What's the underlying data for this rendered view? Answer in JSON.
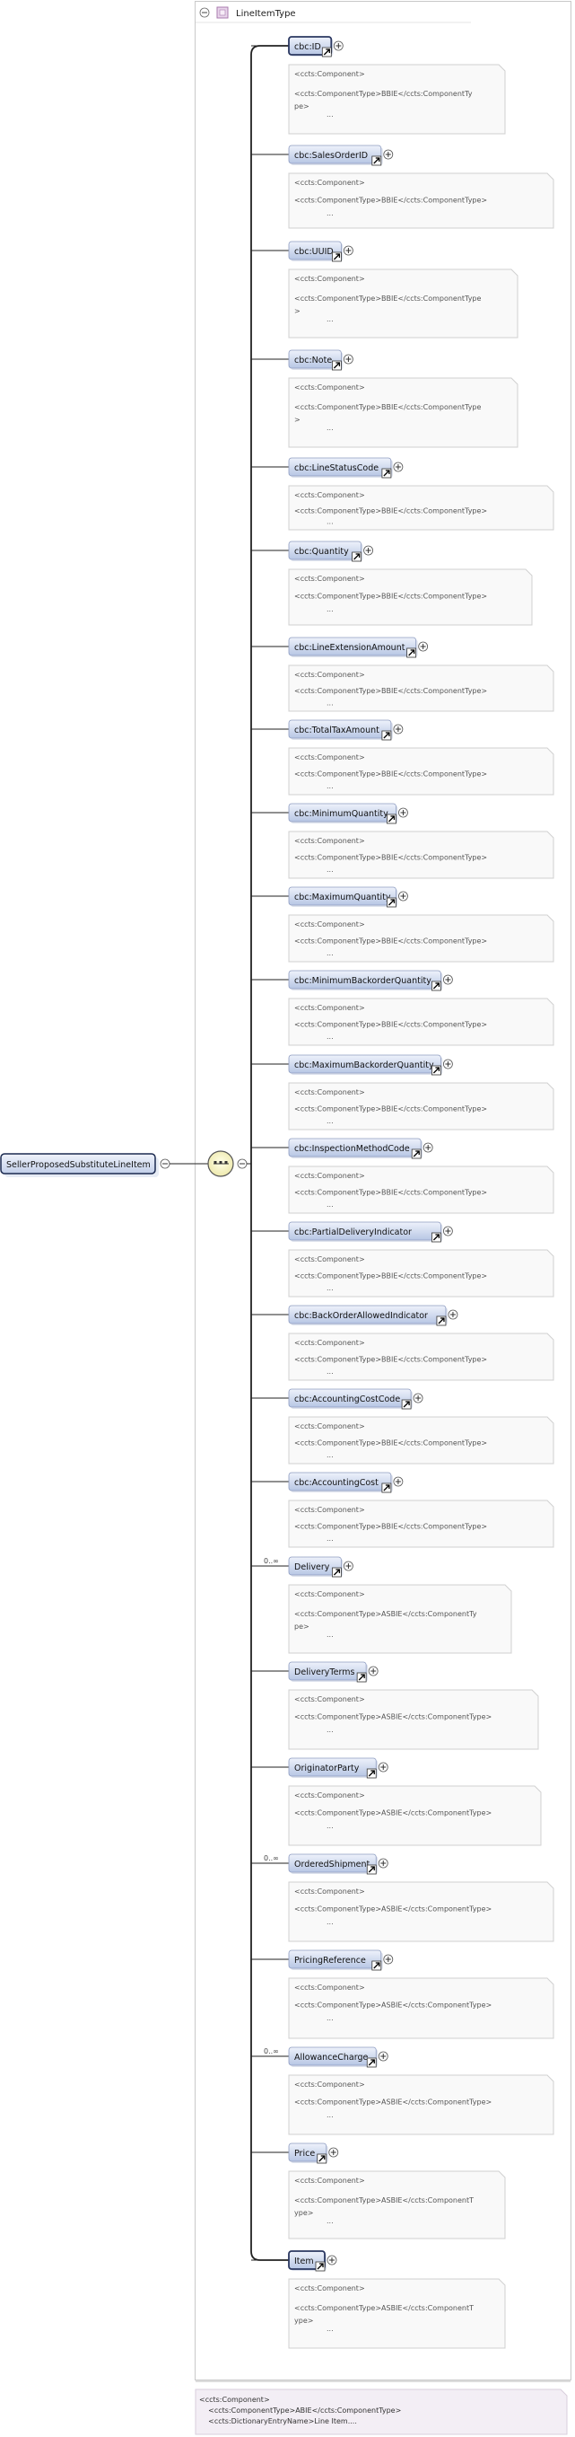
{
  "type_header": {
    "label": "LineItemType",
    "collapse_glyph": "−"
  },
  "root": {
    "label": "SellerProposedSubstituteLineItem"
  },
  "sequence": {
    "icon": "sequence-compositor-icon"
  },
  "elements": [
    {
      "name": "cbc:ID",
      "required": true,
      "multiplicity": "",
      "ann": [
        "<ccts:Component>",
        "<ccts:ComponentType>BBIE</ccts:ComponentTy",
        "pe>",
        "..."
      ]
    },
    {
      "name": "cbc:SalesOrderID",
      "required": false,
      "multiplicity": "",
      "ann": [
        "<ccts:Component>",
        "<ccts:ComponentType>BBIE</ccts:ComponentType>",
        "..."
      ]
    },
    {
      "name": "cbc:UUID",
      "required": false,
      "multiplicity": "",
      "ann": [
        "<ccts:Component>",
        "<ccts:ComponentType>BBIE</ccts:ComponentType",
        ">",
        "..."
      ]
    },
    {
      "name": "cbc:Note",
      "required": false,
      "multiplicity": "",
      "ann": [
        "<ccts:Component>",
        "<ccts:ComponentType>BBIE</ccts:ComponentType",
        ">",
        "..."
      ]
    },
    {
      "name": "cbc:LineStatusCode",
      "required": false,
      "multiplicity": "",
      "ann": [
        "<ccts:Component>",
        "    <ccts:ComponentType>BBIE</ccts:ComponentType>",
        "..."
      ]
    },
    {
      "name": "cbc:Quantity",
      "required": false,
      "multiplicity": "",
      "ann": [
        "<ccts:Component>",
        "<ccts:ComponentType>BBIE</ccts:ComponentType>",
        "..."
      ]
    },
    {
      "name": "cbc:LineExtensionAmount",
      "required": false,
      "multiplicity": "",
      "ann": [
        "<ccts:Component>",
        "    <ccts:ComponentType>BBIE</ccts:ComponentType>",
        "..."
      ]
    },
    {
      "name": "cbc:TotalTaxAmount",
      "required": false,
      "multiplicity": "",
      "ann": [
        "<ccts:Component>",
        "    <ccts:ComponentType>BBIE</ccts:ComponentType>",
        "..."
      ]
    },
    {
      "name": "cbc:MinimumQuantity",
      "required": false,
      "multiplicity": "",
      "ann": [
        "<ccts:Component>",
        "    <ccts:ComponentType>BBIE</ccts:ComponentType>",
        "..."
      ]
    },
    {
      "name": "cbc:MaximumQuantity",
      "required": false,
      "multiplicity": "",
      "ann": [
        "<ccts:Component>",
        "    <ccts:ComponentType>BBIE</ccts:ComponentType>",
        "..."
      ]
    },
    {
      "name": "cbc:MinimumBackorderQuantity",
      "required": false,
      "multiplicity": "",
      "ann": [
        "<ccts:Component>",
        "    <ccts:ComponentType>BBIE</ccts:ComponentType>",
        "..."
      ]
    },
    {
      "name": "cbc:MaximumBackorderQuantity",
      "required": false,
      "multiplicity": "",
      "ann": [
        "<ccts:Component>",
        "    <ccts:ComponentType>BBIE</ccts:ComponentType>",
        "..."
      ]
    },
    {
      "name": "cbc:InspectionMethodCode",
      "required": false,
      "multiplicity": "",
      "ann": [
        "<ccts:Component>",
        "    <ccts:ComponentType>BBIE</ccts:ComponentType>",
        "..."
      ]
    },
    {
      "name": "cbc:PartialDeliveryIndicator",
      "required": false,
      "multiplicity": "",
      "ann": [
        "<ccts:Component>",
        "    <ccts:ComponentType>BBIE</ccts:ComponentType>",
        "..."
      ]
    },
    {
      "name": "cbc:BackOrderAllowedIndicator",
      "required": false,
      "multiplicity": "",
      "ann": [
        "<ccts:Component>",
        "    <ccts:ComponentType>BBIE</ccts:ComponentType>",
        "..."
      ]
    },
    {
      "name": "cbc:AccountingCostCode",
      "required": false,
      "multiplicity": "",
      "ann": [
        "<ccts:Component>",
        "    <ccts:ComponentType>BBIE</ccts:ComponentType>",
        "..."
      ]
    },
    {
      "name": "cbc:AccountingCost",
      "required": false,
      "multiplicity": "",
      "ann": [
        "<ccts:Component>",
        "    <ccts:ComponentType>BBIE</ccts:ComponentType>",
        "..."
      ]
    },
    {
      "name": "Delivery",
      "required": false,
      "multiplicity": "0..∞",
      "ann": [
        "<ccts:Component>",
        "<ccts:ComponentType>ASBIE</ccts:ComponentTy",
        "pe>",
        "..."
      ]
    },
    {
      "name": "DeliveryTerms",
      "required": false,
      "multiplicity": "",
      "ann": [
        "<ccts:Component>",
        "<ccts:ComponentType>ASBIE</ccts:ComponentType>",
        "..."
      ]
    },
    {
      "name": "OriginatorParty",
      "required": false,
      "multiplicity": "",
      "ann": [
        "<ccts:Component>",
        "<ccts:ComponentType>ASBIE</ccts:ComponentType>",
        "..."
      ]
    },
    {
      "name": "OrderedShipment",
      "required": false,
      "multiplicity": "0..∞",
      "ann": [
        "<ccts:Component>",
        "<ccts:ComponentType>ASBIE</ccts:ComponentType>",
        "..."
      ]
    },
    {
      "name": "PricingReference",
      "required": false,
      "multiplicity": "",
      "ann": [
        "<ccts:Component>",
        "<ccts:ComponentType>ASBIE</ccts:ComponentType>",
        "..."
      ]
    },
    {
      "name": "AllowanceCharge",
      "required": false,
      "multiplicity": "0..∞",
      "ann": [
        "<ccts:Component>",
        "<ccts:ComponentType>ASBIE</ccts:ComponentType>",
        "..."
      ]
    },
    {
      "name": "Price",
      "required": false,
      "multiplicity": "",
      "ann": [
        "<ccts:Component>",
        "<ccts:ComponentType>ASBIE</ccts:ComponentT",
        "ype>",
        "..."
      ]
    },
    {
      "name": "Item",
      "required": true,
      "multiplicity": "",
      "ann": [
        "<ccts:Component>",
        "<ccts:ComponentType>ASBIE</ccts:ComponentT",
        "ype>",
        "..."
      ]
    }
  ],
  "bottom_annotation": [
    "<ccts:Component>",
    "    <ccts:ComponentType>ABIE</ccts:ComponentType>",
    "    <ccts:DictionaryEntryName>Line Item...."
  ],
  "colors": {
    "element_fill_top": "#e9eefa",
    "element_fill_bottom": "#b9c8e6",
    "element_stroke": "#1b2a50",
    "line": "#222222",
    "card_border": "#cfcfcf",
    "card_fill": "#f8f8f8",
    "bottom_fill": "#f3eef5"
  }
}
